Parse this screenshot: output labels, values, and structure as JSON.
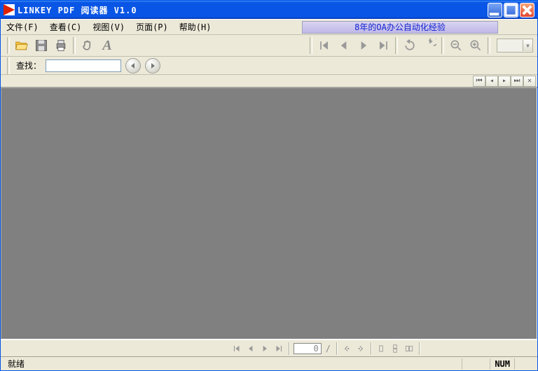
{
  "window": {
    "title": "LINKEY PDF 阅读器 V1.0"
  },
  "menu": {
    "file": "文件(F)",
    "view": "查看(C)",
    "view2": "视图(V)",
    "page": "页面(P)",
    "help": "帮助(H)"
  },
  "banner": "8年的OA办公自动化经验",
  "find": {
    "label": "查找：",
    "value": ""
  },
  "nav": {
    "page_value": "0",
    "page_total": "/"
  },
  "status": {
    "ready": "就绪",
    "num": "NUM"
  },
  "icons": {
    "open": "open-folder",
    "save": "floppy",
    "print": "printer",
    "hand": "hand",
    "text": "A",
    "first": "⏮",
    "prev": "◀",
    "next": "▶",
    "last": "⏭",
    "rotate_ccw": "↺",
    "rotate_cw": "↻",
    "zoom_out": "⊖",
    "zoom_in": "⊕"
  }
}
